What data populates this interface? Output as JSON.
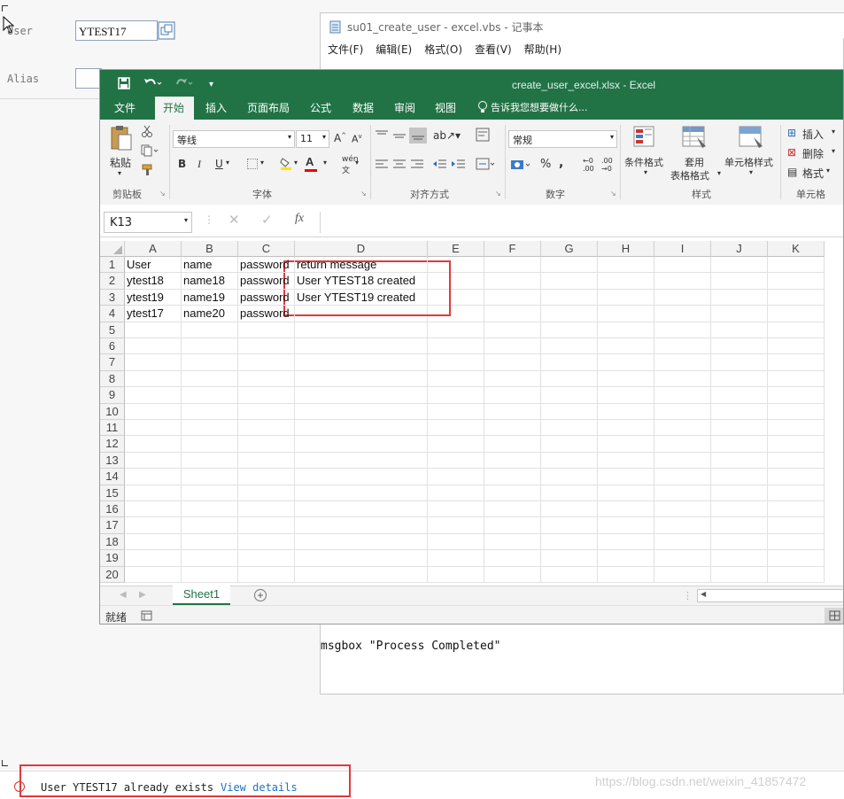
{
  "sap": {
    "user_label": "User",
    "user_value": "YTEST17",
    "alias_label": "Alias",
    "message_text": "User YTEST17 already exists",
    "message_link": "View details",
    "watermark": "https://blog.csdn.net/weixin_41857472"
  },
  "notepad": {
    "title": "su01_create_user - excel.vbs - 记事本",
    "menu": [
      "文件(F)",
      "编辑(E)",
      "格式(O)",
      "查看(V)",
      "帮助(H)"
    ],
    "body_line": "msgbox \"Process Completed\""
  },
  "excel": {
    "title": "create_user_excel.xlsx - Excel",
    "tabs": [
      "文件",
      "开始",
      "插入",
      "页面布局",
      "公式",
      "数据",
      "审阅",
      "视图"
    ],
    "active_tab": "开始",
    "tell_me": "告诉我您想要做什么...",
    "ribbon": {
      "paste": "粘贴",
      "clipboard": "剪贴板",
      "font_name": "等线",
      "font_size": "11",
      "font_group": "字体",
      "align_group": "对齐方式",
      "number_format": "常规",
      "number_group": "数字",
      "cond_format": "条件格式",
      "table_format_1": "套用",
      "table_format_2": "表格格式",
      "cell_style": "单元格样式",
      "style_group": "样式",
      "insert": "插入",
      "delete": "删除",
      "format": "格式",
      "cells_group": "单元格"
    },
    "name_box": "K13",
    "columns": [
      "A",
      "B",
      "C",
      "D",
      "E",
      "F",
      "G",
      "H",
      "I",
      "J",
      "K"
    ],
    "rows": [
      "1",
      "2",
      "3",
      "4",
      "5",
      "6",
      "7",
      "8",
      "9",
      "10",
      "11",
      "12",
      "13",
      "14",
      "15",
      "16",
      "17",
      "18",
      "19",
      "20"
    ],
    "cells": [
      [
        "User",
        "name",
        "password",
        "return message"
      ],
      [
        "ytest18",
        "name18",
        "password",
        "User YTEST18 created"
      ],
      [
        "ytest19",
        "name19",
        "password",
        "User YTEST19 created"
      ],
      [
        "ytest17",
        "name20",
        "password",
        ""
      ]
    ],
    "sheet_tab": "Sheet1",
    "status": "就绪"
  },
  "colors": {
    "excel_green": "#217346",
    "highlight_red": "#e0393e",
    "link_blue": "#1a73c9",
    "error_red": "#d93025"
  }
}
